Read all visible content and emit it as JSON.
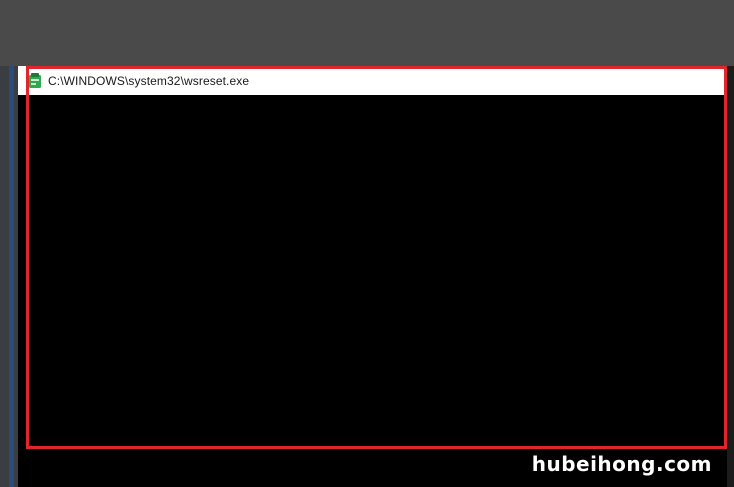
{
  "window": {
    "title": "C:\\WINDOWS\\system32\\wsreset.exe",
    "icon": "console-app-icon"
  },
  "watermark": {
    "text": "hubeihong.com"
  },
  "colors": {
    "background": "#000000",
    "top_band": "#4a4a4a",
    "title_bar": "#ffffff",
    "highlight": "#e0262c",
    "icon_green": "#2fa84f"
  }
}
